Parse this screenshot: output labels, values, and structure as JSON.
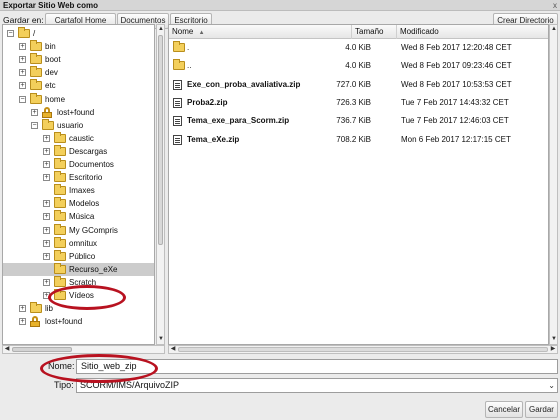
{
  "window": {
    "title": "Exportar Sitio Web como",
    "close_glyph": "x"
  },
  "save_in": {
    "label": "Gardar en:",
    "path_buttons": [
      "Cartafol Home",
      "Documentos",
      "Escritorio"
    ],
    "create_folder": "Crear Directorio"
  },
  "tree": {
    "items": [
      {
        "label": "/",
        "expander": "⊟",
        "icon": "folder-open-icon"
      },
      {
        "label": "bin",
        "expander": "⊞",
        "icon": "folder-icon"
      },
      {
        "label": "boot",
        "expander": "⊞",
        "icon": "folder-icon"
      },
      {
        "label": "dev",
        "expander": "⊞",
        "icon": "folder-icon"
      },
      {
        "label": "etc",
        "expander": "⊞",
        "icon": "folder-icon"
      },
      {
        "label": "home",
        "expander": "⊟",
        "icon": "folder-open-icon"
      },
      {
        "label": "lost+found",
        "expander": "⊞",
        "icon": "lock-icon"
      },
      {
        "label": "usuario",
        "expander": "⊟",
        "icon": "folder-open-icon"
      },
      {
        "label": "caustic",
        "expander": "⊞",
        "icon": "folder-icon"
      },
      {
        "label": "Descargas",
        "expander": "⊞",
        "icon": "folder-icon"
      },
      {
        "label": "Documentos",
        "expander": "⊞",
        "icon": "folder-icon"
      },
      {
        "label": "Escritorio",
        "expander": "⊞",
        "icon": "folder-icon"
      },
      {
        "label": "Imaxes",
        "expander": "",
        "icon": "folder-icon"
      },
      {
        "label": "Modelos",
        "expander": "⊞",
        "icon": "folder-icon"
      },
      {
        "label": "Música",
        "expander": "⊞",
        "icon": "folder-icon"
      },
      {
        "label": "My GCompris",
        "expander": "⊞",
        "icon": "folder-icon"
      },
      {
        "label": "omnitux",
        "expander": "⊞",
        "icon": "folder-icon"
      },
      {
        "label": "Público",
        "expander": "⊞",
        "icon": "folder-icon"
      },
      {
        "label": "Recurso_eXe",
        "expander": "",
        "icon": "folder-icon",
        "selected": true
      },
      {
        "label": "Scratch",
        "expander": "⊞",
        "icon": "folder-icon"
      },
      {
        "label": "Vídeos",
        "expander": "⊞",
        "icon": "folder-icon"
      },
      {
        "label": "lib",
        "expander": "⊞",
        "icon": "folder-icon"
      },
      {
        "label": "lost+found",
        "expander": "⊞",
        "icon": "lock-icon"
      }
    ]
  },
  "filelist": {
    "headers": {
      "name": "Nome",
      "sort_glyph": "▲",
      "size": "Tamaño",
      "modified": "Modificado"
    },
    "rows": [
      {
        "name": ".",
        "size": "4.0 KiB",
        "modified": "Wed 8 Feb 2017 12:20:48 CET",
        "icon": "folder-icon",
        "bold": false
      },
      {
        "name": "..",
        "size": "4.0 KiB",
        "modified": "Wed 8 Feb 2017 09:23:46 CET",
        "icon": "folder-icon",
        "bold": false
      },
      {
        "name": "Exe_con_proba_avaliativa.zip",
        "size": "727.0 KiB",
        "modified": "Wed 8 Feb 2017 10:53:53 CET",
        "icon": "document-icon",
        "bold": true
      },
      {
        "name": "Proba2.zip",
        "size": "726.3 KiB",
        "modified": "Tue 7 Feb 2017 14:43:32 CET",
        "icon": "document-icon",
        "bold": true
      },
      {
        "name": "Tema_exe_para_Scorm.zip",
        "size": "736.7 KiB",
        "modified": "Tue 7 Feb 2017 12:46:03 CET",
        "icon": "document-icon",
        "bold": true
      },
      {
        "name": "Tema_eXe.zip",
        "size": "708.2 KiB",
        "modified": "Mon 6 Feb 2017 12:17:15 CET",
        "icon": "document-icon",
        "bold": true
      }
    ]
  },
  "form": {
    "name_label": "Nome:",
    "name_value": "Sitio_web_zip",
    "type_label": "Tipo:",
    "type_value": "SCORM/IMS/ArquivoZIP"
  },
  "actions": {
    "cancel": "Cancelar",
    "save": "Gardar"
  },
  "colors": {
    "highlight_ring": "#b81220",
    "selected_row": "#cccccc",
    "folder": "#f3cf5b"
  }
}
